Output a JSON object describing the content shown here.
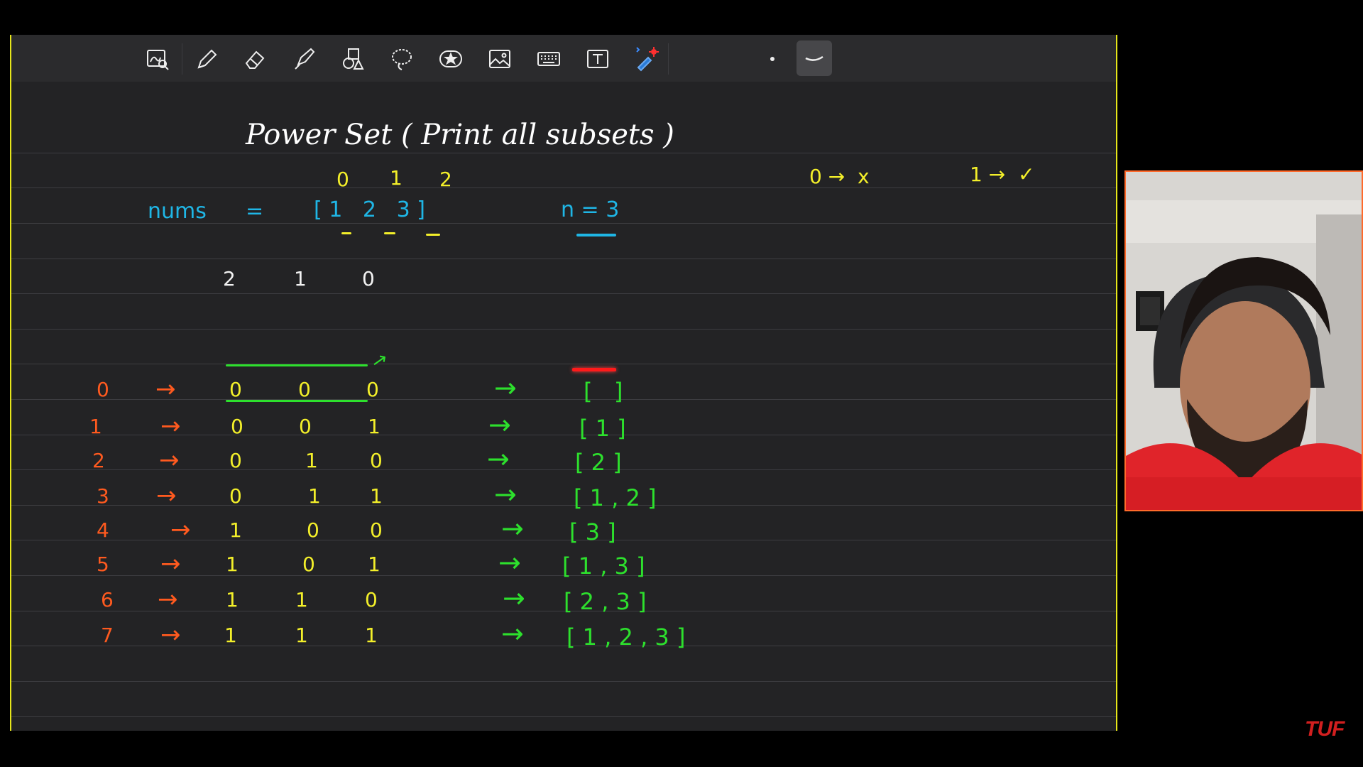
{
  "toolbar": {
    "tools": [
      {
        "icon": "zoom-region-icon"
      },
      {
        "icon": "pen-icon"
      },
      {
        "icon": "eraser-icon"
      },
      {
        "icon": "highlighter-icon"
      },
      {
        "icon": "shapes-icon"
      },
      {
        "icon": "lasso-icon"
      },
      {
        "icon": "sticker-icon"
      },
      {
        "icon": "image-icon"
      },
      {
        "icon": "keyboard-icon"
      },
      {
        "icon": "text-box-icon"
      },
      {
        "icon": "laser-pointer-icon"
      },
      {
        "icon": "dot-size-icon"
      },
      {
        "icon": "stroke-style-icon"
      }
    ]
  },
  "board": {
    "title": "Power Set ( Print all subsets )",
    "legend_zero": "0 →  x",
    "legend_one": "1 →  ✓",
    "indices": [
      "0",
      "1",
      "2"
    ],
    "nums_label": "nums",
    "equals": "=",
    "nums_values": "[ 1   2   3 ]",
    "n_label": "n = 3",
    "bit_positions": [
      "2",
      "1",
      "0"
    ],
    "arrow": "→",
    "rows": [
      {
        "num": "0",
        "bits": [
          "0",
          "0",
          "0"
        ],
        "subset": "[   ]"
      },
      {
        "num": "1",
        "bits": [
          "0",
          "0",
          "1"
        ],
        "subset": "[ 1 ]"
      },
      {
        "num": "2",
        "bits": [
          "0",
          "1",
          "0"
        ],
        "subset": "[ 2 ]"
      },
      {
        "num": "3",
        "bits": [
          "0",
          "1",
          "1"
        ],
        "subset": "[ 1 , 2 ]"
      },
      {
        "num": "4",
        "bits": [
          "1",
          "0",
          "0"
        ],
        "subset": "[ 3 ]"
      },
      {
        "num": "5",
        "bits": [
          "1",
          "0",
          "1"
        ],
        "subset": "[ 1 , 3 ]"
      },
      {
        "num": "6",
        "bits": [
          "1",
          "1",
          "0"
        ],
        "subset": "[ 2 , 3 ]"
      },
      {
        "num": "7",
        "bits": [
          "1",
          "1",
          "1"
        ],
        "subset": "[ 1 , 2 , 3 ]"
      }
    ]
  },
  "watermark": "TUF",
  "colors": {
    "board_bg": "#232325",
    "title": "#ffffff",
    "indices": "#f3ef2a",
    "nums": "#1fb6e6",
    "row_numbers": "#ff5a1f",
    "subsets": "#2de02d",
    "highlight": "#ff1a1a"
  }
}
